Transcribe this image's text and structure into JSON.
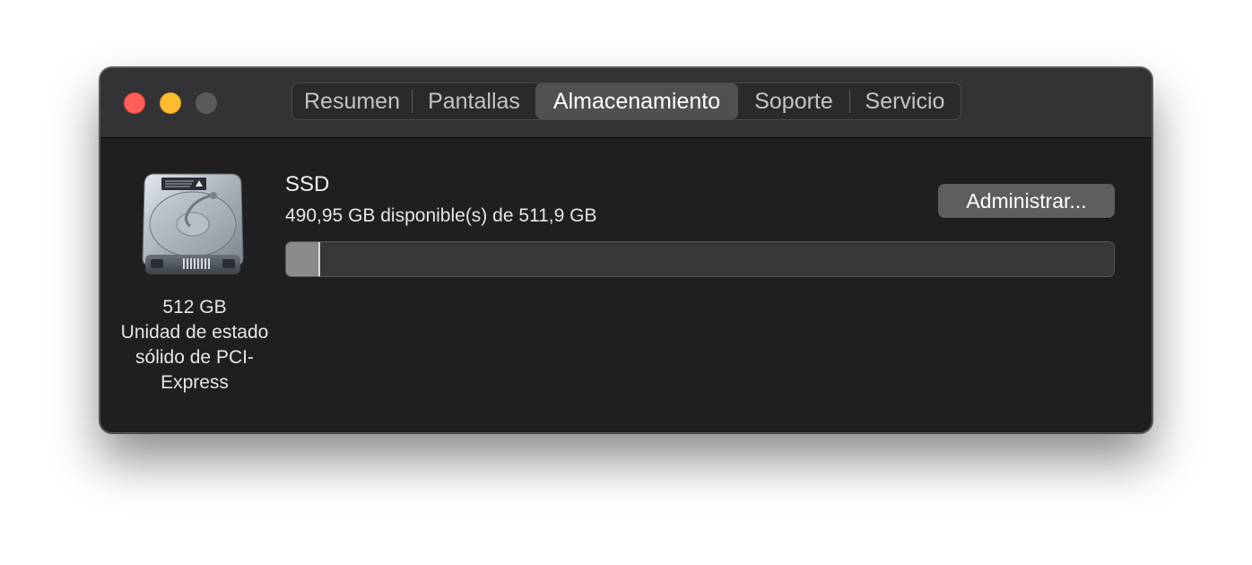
{
  "window": {
    "tabs": [
      {
        "label": "Resumen"
      },
      {
        "label": "Pantallas"
      },
      {
        "label": "Almacenamiento",
        "active": true
      },
      {
        "label": "Soporte"
      },
      {
        "label": "Servicio"
      }
    ]
  },
  "drive": {
    "icon": "hard-drive-icon",
    "capacity": "512 GB",
    "type_line1": "Unidad de estado",
    "type_line2": "sólido de PCI-",
    "type_line3": "Express"
  },
  "volume": {
    "name": "SSD",
    "availability": "490,95 GB disponible(s) de 511,9 GB",
    "used_fraction": 0.041,
    "manage_label": "Administrar..."
  },
  "colors": {
    "close": "#fe5f57",
    "minimize": "#febc2e",
    "zoom_disabled": "#5a5a5c"
  }
}
